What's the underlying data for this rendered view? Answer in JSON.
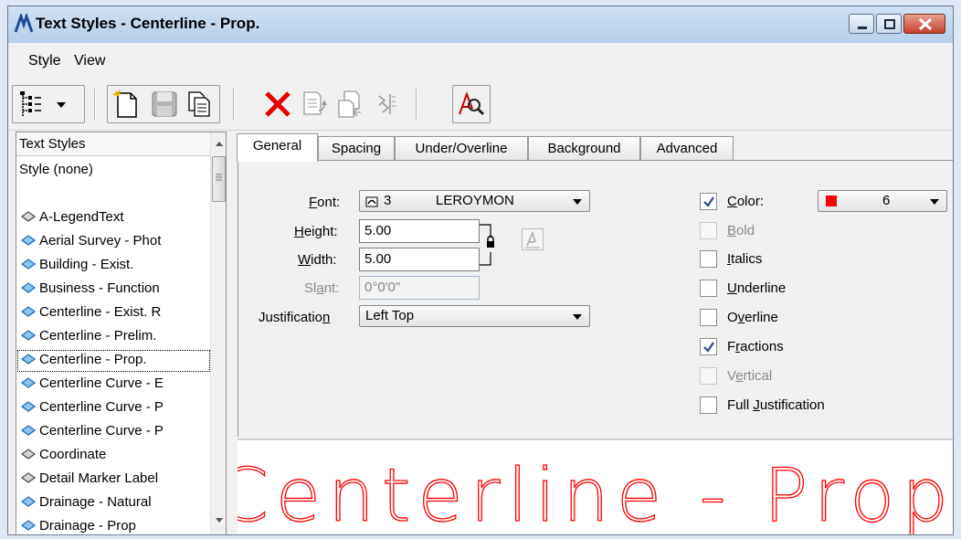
{
  "window": {
    "title": "Text Styles - Centerline - Prop."
  },
  "menu": {
    "style": "Style",
    "view": "View"
  },
  "list": {
    "header": "Text Styles",
    "none_item": "Style (none)",
    "items": [
      "A-LegendText",
      "Aerial Survey - Phot",
      "Building - Exist.",
      "Business - Function",
      "Centerline - Exist. R",
      "Centerline - Prelim.",
      "Centerline - Prop.",
      "Centerline Curve - E",
      "Centerline Curve - P",
      "Centerline Curve - P",
      "Coordinate",
      "Detail Marker Label",
      "Drainage - Natural",
      "Drainage - Prop"
    ],
    "selected_index": 6
  },
  "tabs": [
    "General",
    "Spacing",
    "Under/Overline",
    "Background",
    "Advanced"
  ],
  "general": {
    "font_label": "Font:",
    "font_number": "3",
    "font_name": "LEROYMON",
    "height_label": "Height:",
    "height_value": "5.00",
    "width_label": "Width:",
    "width_value": "5.00",
    "slant_label": "Slant:",
    "slant_value": "0°0'0\"",
    "justification_label": "Justification",
    "justification_value": "Left Top",
    "color_label": "Color:",
    "color_value": "6",
    "color_swatch": "#ff0000",
    "bold_label": "Bold",
    "italics_label": "Italics",
    "underline_label": "Underline",
    "overline_label": "Overline",
    "fractions_label": "Fractions",
    "vertical_label": "Vertical",
    "full_justification_label": "Full Justification",
    "color_checked": true,
    "fractions_checked": true
  },
  "preview": {
    "text": "Centerline - Prop",
    "color": "#ff0000"
  }
}
